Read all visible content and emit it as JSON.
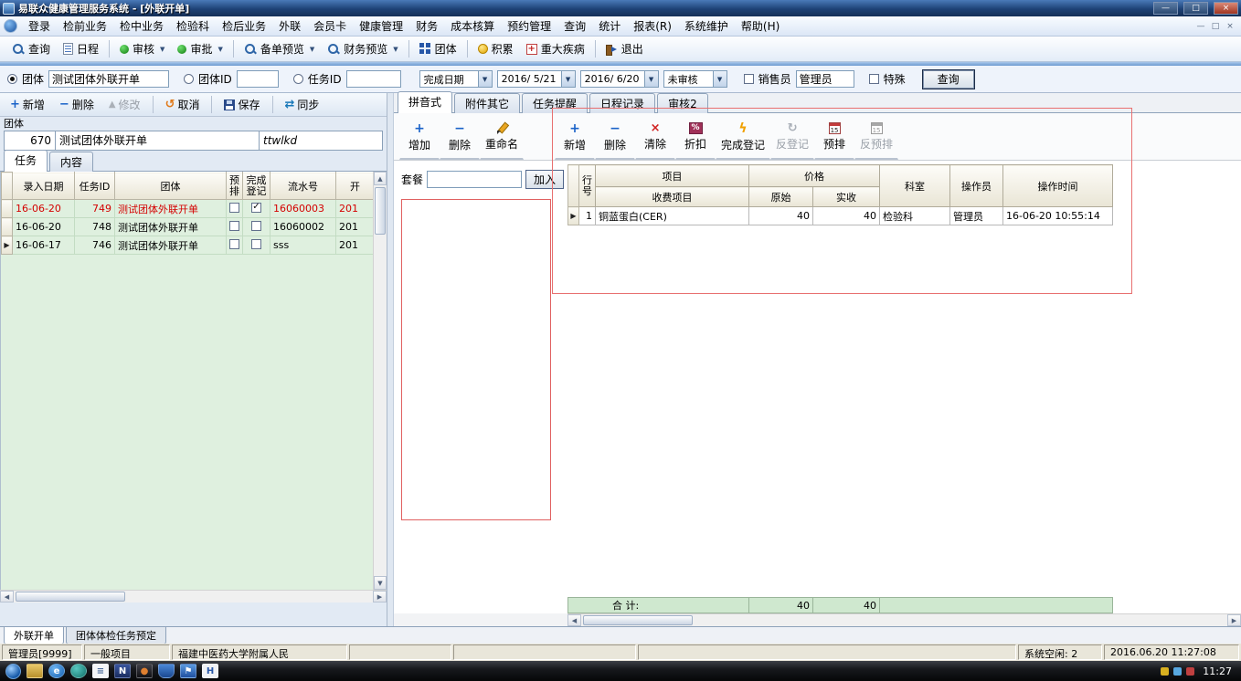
{
  "titlebar": {
    "title": "易联众健康管理服务系统 - [外联开单]",
    "minimize": "—",
    "maximize": "□",
    "close": "×"
  },
  "menubar": {
    "items": [
      "登录",
      "检前业务",
      "检中业务",
      "检验科",
      "检后业务",
      "外联",
      "会员卡",
      "健康管理",
      "财务",
      "成本核算",
      "预约管理",
      "查询",
      "统计",
      "报表(R)",
      "系统维护",
      "帮助(H)"
    ],
    "mdi": {
      "min": "—",
      "restore": "□",
      "close": "×"
    }
  },
  "toolbar": {
    "items": [
      "查询",
      "日程",
      "审核",
      "审批",
      "备单预览",
      "财务预览",
      "团体",
      "积累",
      "重大疾病",
      "退出"
    ]
  },
  "filter": {
    "group_label": "团体",
    "group_value": "测试团体外联开单",
    "group_on": "true",
    "group_id_label": "团体ID",
    "group_id_value": "",
    "group_id_on": "false",
    "task_id_label": "任务ID",
    "task_id_value": "",
    "task_id_on": "false",
    "date_type": "完成日期",
    "date_from": "2016/ 5/21",
    "date_to": "2016/ 6/20",
    "audit_state": "未审核",
    "sales_label": "销售员",
    "sales_checked": "false",
    "sales_value": "管理员",
    "special_label": "特殊",
    "special_checked": "false",
    "query_label": "查询"
  },
  "left": {
    "actions": [
      {
        "label": "新增",
        "enabled": "true"
      },
      {
        "label": "删除",
        "enabled": "true"
      },
      {
        "label": "修改",
        "enabled": "false"
      },
      {
        "label": "取消",
        "enabled": "true"
      },
      {
        "label": "保存",
        "enabled": "true"
      },
      {
        "label": "同步",
        "enabled": "true"
      }
    ],
    "group_box_label": "团体",
    "group_no": "670",
    "group_name": "测试团体外联开单",
    "group_code": "ttwlkd",
    "tabs": [
      "任务",
      "内容"
    ],
    "table": {
      "headers": [
        "录入日期",
        "任务ID",
        "团体",
        "预排",
        "完成登记",
        "流水号",
        "开"
      ],
      "rows": [
        {
          "marker": "",
          "date": "16-06-20",
          "task_id": "749",
          "group": "测试团体外联开单",
          "pre": "false",
          "done": "true",
          "serial": "16060003",
          "open": "201",
          "flag": "red"
        },
        {
          "marker": "",
          "date": "16-06-20",
          "task_id": "748",
          "group": "测试团体外联开单",
          "pre": "false",
          "done": "false",
          "serial": "16060002",
          "open": "201",
          "flag": "normal"
        },
        {
          "marker": "▶",
          "date": "16-06-17",
          "task_id": "746",
          "group": "测试团体外联开单",
          "pre": "false",
          "done": "false",
          "serial": "sss",
          "open": "201",
          "flag": "normal"
        }
      ]
    }
  },
  "right": {
    "tabs": [
      "拼音式",
      "附件其它",
      "任务提醒",
      "日程记录",
      "审核2"
    ],
    "list_actions": [
      "增加",
      "删除",
      "重命名"
    ],
    "item_actions": [
      {
        "label": "新增",
        "enabled": "true"
      },
      {
        "label": "删除",
        "enabled": "true"
      },
      {
        "label": "清除",
        "enabled": "true"
      },
      {
        "label": "折扣",
        "enabled": "true"
      },
      {
        "label": "完成登记",
        "enabled": "true"
      },
      {
        "label": "反登记",
        "enabled": "false"
      },
      {
        "label": "预排",
        "enabled": "true"
      },
      {
        "label": "反预排",
        "enabled": "false"
      }
    ],
    "package_label": "套餐",
    "package_value": "",
    "join_label": "加入",
    "items_table": {
      "col_row_no": "行号",
      "col_item": "项目",
      "col_fee_item": "收费项目",
      "col_price": "价格",
      "col_original": "原始",
      "col_actual": "实收",
      "col_dept": "科室",
      "col_operator": "操作员",
      "col_time": "操作时间",
      "rows": [
        {
          "marker": "▶",
          "no": "1",
          "name": "铜蓝蛋白(CER)",
          "original": "40",
          "actual": "40",
          "dept": "检验科",
          "operator": "管理员",
          "time": "16-06-20 10:55:14"
        }
      ],
      "total_label": "合  计:",
      "total_original": "40",
      "total_actual": "40"
    }
  },
  "bottom_tabs": [
    "外联开单",
    "团体体检任务预定"
  ],
  "statusbar": {
    "user": "管理员[9999]",
    "project_type": "一般项目",
    "org": "福建中医药大学附属人民",
    "idle": "系统空闲: 2",
    "datetime": "2016.06.20 11:27:08"
  },
  "taskbar": {
    "clock": "11:27"
  }
}
